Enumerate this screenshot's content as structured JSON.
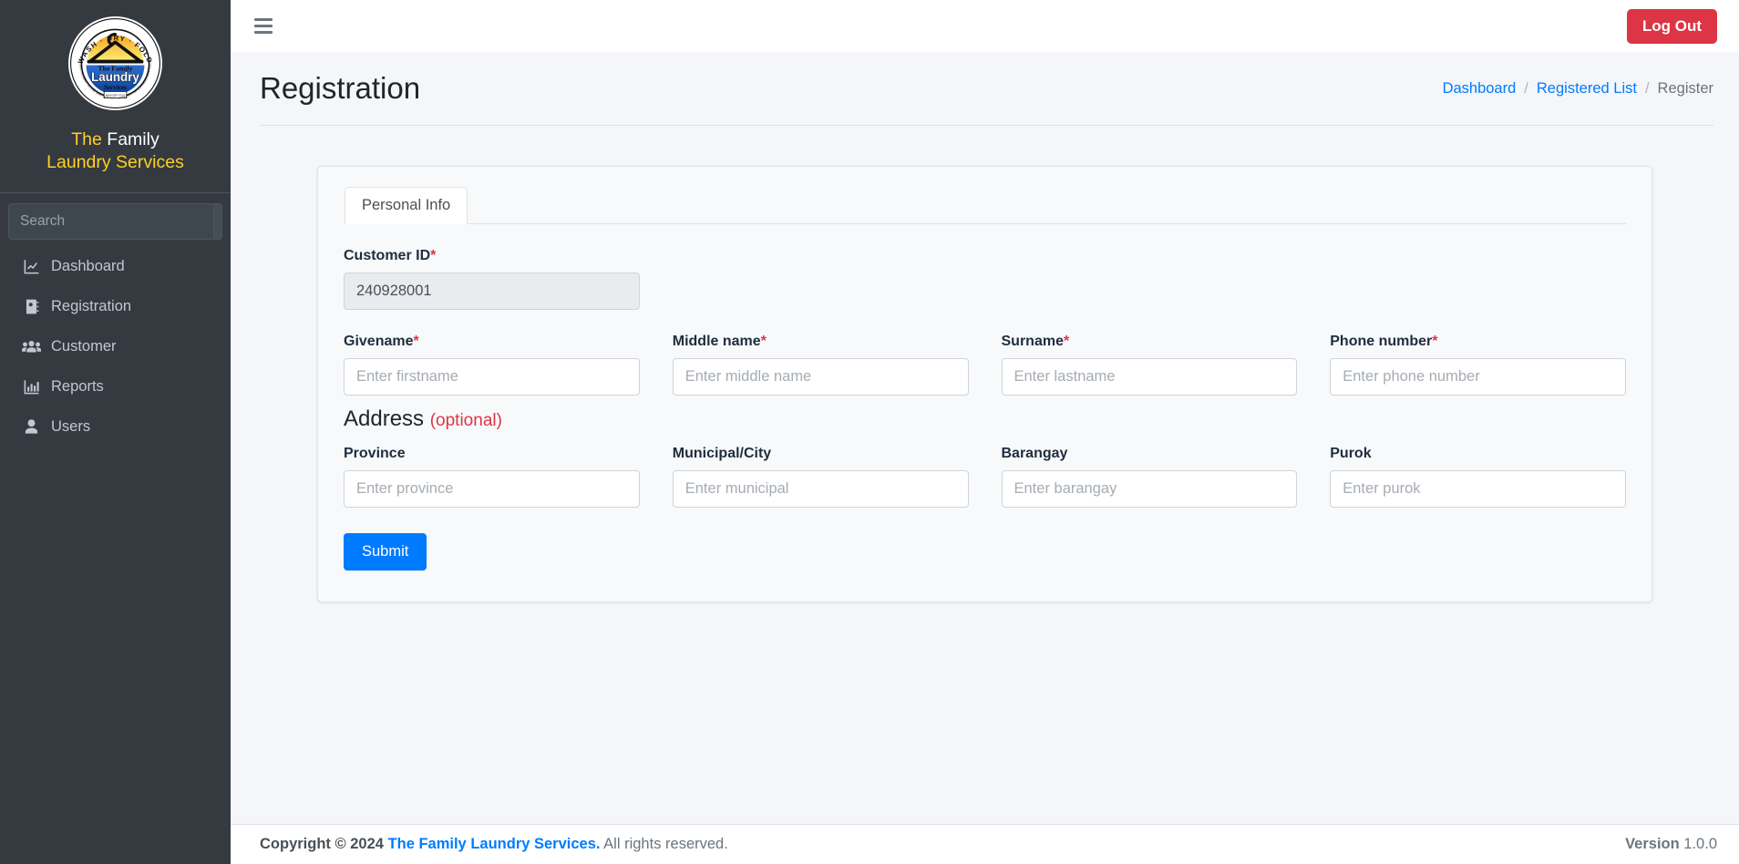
{
  "sidebar": {
    "logo": {
      "icon": "laundry-logo",
      "arc_top": "WASH · DRY · FOLD",
      "line1": "The Family",
      "line2": "Laundry",
      "line3": "Services",
      "arc_bottom": "NATIONAL HIGHWAY VILLAGE SANTIAGO CITY UNIVERSITY OF NORTHEASTERN COLLEGE"
    },
    "brand": {
      "word1": "The",
      "word2": "Family",
      "word3": "Laundry Services"
    },
    "search": {
      "placeholder": "Search",
      "value": "",
      "button_icon": "search-icon"
    },
    "items": [
      {
        "label": "Dashboard",
        "icon": "chart-line-icon",
        "active": false
      },
      {
        "label": "Registration",
        "icon": "address-book-icon",
        "active": false
      },
      {
        "label": "Customer",
        "icon": "users-icon",
        "active": false
      },
      {
        "label": "Reports",
        "icon": "chart-bar-icon",
        "active": false
      },
      {
        "label": "Users",
        "icon": "user-icon",
        "active": false
      }
    ]
  },
  "navbar": {
    "menu_icon": "hamburger-icon",
    "logout_label": "Log Out"
  },
  "header": {
    "title": "Registration",
    "breadcrumb": [
      {
        "label": "Dashboard",
        "type": "link"
      },
      {
        "label": "/",
        "type": "sep"
      },
      {
        "label": "Registered List",
        "type": "link"
      },
      {
        "label": "/",
        "type": "sep"
      },
      {
        "label": "Register",
        "type": "current"
      }
    ]
  },
  "form": {
    "tabs": [
      {
        "label": "Personal Info",
        "active": true
      }
    ],
    "customer_id": {
      "label": "Customer ID",
      "required": "*",
      "value": "240928001",
      "readonly": true
    },
    "name_fields": [
      {
        "label": "Givename",
        "required": "*",
        "placeholder": "Enter firstname",
        "value": ""
      },
      {
        "label": "Middle name",
        "required": "*",
        "placeholder": "Enter middle name",
        "value": ""
      },
      {
        "label": "Surname",
        "required": "*",
        "placeholder": "Enter lastname",
        "value": ""
      },
      {
        "label": "Phone number",
        "required": "*",
        "placeholder": "Enter phone number",
        "value": ""
      }
    ],
    "address_section": {
      "title": "Address",
      "optional_label": "(optional)"
    },
    "address_fields": [
      {
        "label": "Province",
        "required": "",
        "placeholder": "Enter province",
        "value": ""
      },
      {
        "label": "Municipal/City",
        "required": "",
        "placeholder": "Enter municipal",
        "value": ""
      },
      {
        "label": "Barangay",
        "required": "",
        "placeholder": "Enter barangay",
        "value": ""
      },
      {
        "label": "Purok",
        "required": "",
        "placeholder": "Enter purok",
        "value": ""
      }
    ],
    "submit_label": "Submit"
  },
  "footer": {
    "copyright_prefix": "Copyright © 2024",
    "company": "The Family Laundry Services.",
    "rights": "All rights reserved.",
    "version_label": "Version",
    "version_number": "1.0.0"
  },
  "colors": {
    "sidebar_bg": "#343a40",
    "brand_gold": "#ffd024",
    "accent_blue": "#007bff",
    "danger_red": "#dc3545",
    "page_bg": "#f4f6f9",
    "card_bg": "#f8f9fa"
  }
}
